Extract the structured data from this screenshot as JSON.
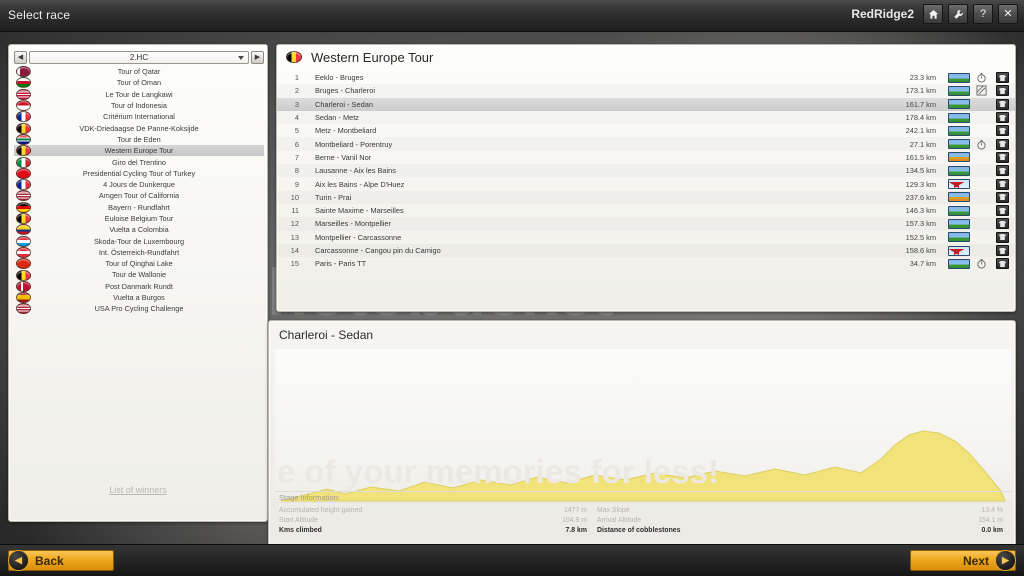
{
  "titlebar": {
    "title": "Select race",
    "user": "RedRidge2",
    "buttons": [
      {
        "name": "home-icon",
        "glyph": "⌂"
      },
      {
        "name": "wrench-icon",
        "glyph": "⚒"
      },
      {
        "name": "help-icon",
        "glyph": "?"
      },
      {
        "name": "close-icon",
        "glyph": "✕"
      }
    ]
  },
  "watermark": {
    "main": "photobucket",
    "sub": "Protect more of your memories for less!",
    "graph": "e of your memories for less!"
  },
  "left_panel": {
    "category_selector": {
      "value": "2.HC",
      "prev_label": "◀",
      "next_label": "▶"
    },
    "winners_link": "List of winners",
    "races": [
      {
        "name": "Tour of Qatar",
        "flag": "qatar",
        "selected": false
      },
      {
        "name": "Tour of Oman",
        "flag": "oman",
        "selected": false
      },
      {
        "name": "Le Tour de Langkawi",
        "flag": "malaysia",
        "selected": false
      },
      {
        "name": "Tour of Indonesia",
        "flag": "indonesia",
        "selected": false
      },
      {
        "name": "Critérium International",
        "flag": "france",
        "selected": false
      },
      {
        "name": "VDK-Driedaagse De Panne-Koksijde",
        "flag": "belgium",
        "selected": false
      },
      {
        "name": "Tour de Eden",
        "flag": "southafrica",
        "selected": false
      },
      {
        "name": "Western Europe Tour",
        "flag": "belgium",
        "selected": true
      },
      {
        "name": "Giro del Trentino",
        "flag": "italy",
        "selected": false
      },
      {
        "name": "Presidential Cycling Tour of Turkey",
        "flag": "turkey",
        "selected": false
      },
      {
        "name": "4 Jours de Dunkerque",
        "flag": "france",
        "selected": false
      },
      {
        "name": "Amgen Tour of California",
        "flag": "usa",
        "selected": false
      },
      {
        "name": "Bayern - Rundfahrt",
        "flag": "germany",
        "selected": false
      },
      {
        "name": "Euloise Belgium Tour",
        "flag": "belgium",
        "selected": false
      },
      {
        "name": "Vuelta a Colombia",
        "flag": "colombia",
        "selected": false
      },
      {
        "name": "Skoda-Tour de Luxembourg",
        "flag": "luxembourg",
        "selected": false
      },
      {
        "name": "Int. Österreich-Rundfahrt",
        "flag": "austria",
        "selected": false
      },
      {
        "name": "Tour of Qinghai Lake",
        "flag": "china",
        "selected": false
      },
      {
        "name": "Tour de Wallonie",
        "flag": "belgium",
        "selected": false
      },
      {
        "name": "Post Danmark Rundt",
        "flag": "denmark",
        "selected": false
      },
      {
        "name": "Vuelta a Burgos",
        "flag": "spain",
        "selected": false
      },
      {
        "name": "USA Pro Cycling Challenge",
        "flag": "usa",
        "selected": false
      }
    ]
  },
  "stage_panel": {
    "race_title": "Western Europe Tour",
    "race_flag": "belgium",
    "stages": [
      {
        "num": "1",
        "name": "Eeklo - Bruges",
        "distance": "23.3 km",
        "profile": "flat",
        "timetrial": "stopwatch",
        "selected": false
      },
      {
        "num": "2",
        "name": "Bruges - Charleroi",
        "distance": "173.1 km",
        "profile": "flat",
        "timetrial": "cobbles",
        "selected": false
      },
      {
        "num": "3",
        "name": "Charleroi - Sedan",
        "distance": "161.7 km",
        "profile": "flat",
        "timetrial": "",
        "selected": true
      },
      {
        "num": "4",
        "name": "Sedan - Metz",
        "distance": "178.4 km",
        "profile": "flat",
        "timetrial": "",
        "selected": false
      },
      {
        "num": "5",
        "name": "Metz - Montbeliard",
        "distance": "242.1 km",
        "profile": "flat",
        "timetrial": "",
        "selected": false
      },
      {
        "num": "6",
        "name": "Montbeliard - Porentruy",
        "distance": "27.1 km",
        "profile": "flat",
        "timetrial": "stopwatch",
        "selected": false
      },
      {
        "num": "7",
        "name": "Berne - Vanil Nor",
        "distance": "161.5 km",
        "profile": "hill",
        "timetrial": "",
        "selected": false
      },
      {
        "num": "8",
        "name": "Lausanne - Aix les Bains",
        "distance": "134.5 km",
        "profile": "flat",
        "timetrial": "",
        "selected": false
      },
      {
        "num": "9",
        "name": "Aix les Bains - Alpe D'Huez",
        "distance": "129.3 km",
        "profile": "mountain",
        "timetrial": "",
        "selected": false
      },
      {
        "num": "10",
        "name": "Turin - Prai",
        "distance": "237.6 km",
        "profile": "hill",
        "timetrial": "",
        "selected": false
      },
      {
        "num": "11",
        "name": "Sainte Maxime - Marseilles",
        "distance": "146.3 km",
        "profile": "flat",
        "timetrial": "",
        "selected": false
      },
      {
        "num": "12",
        "name": "Marseilles - Montpellier",
        "distance": "157.3 km",
        "profile": "flat",
        "timetrial": "",
        "selected": false
      },
      {
        "num": "13",
        "name": "Montpellier - Carcassonne",
        "distance": "152.5 km",
        "profile": "flat",
        "timetrial": "",
        "selected": false
      },
      {
        "num": "14",
        "name": "Carcassonne - Cangou pin du Camigo",
        "distance": "158.6 km",
        "profile": "mountain",
        "timetrial": "",
        "selected": false
      },
      {
        "num": "15",
        "name": "Paris - Paris TT",
        "distance": "34.7 km",
        "profile": "flat",
        "timetrial": "stopwatch",
        "selected": false
      }
    ]
  },
  "detail_panel": {
    "title": "Charleroi - Sedan",
    "stage_information_label": "Stage information:",
    "info": [
      {
        "left_label": "Accumulated height gained",
        "left_value": "1477 m",
        "right_label": "Max Slope",
        "right_value": "13.4 %",
        "bold": false
      },
      {
        "left_label": "Start Altitude",
        "left_value": "104.9 m",
        "right_label": "Arrival Altitude",
        "right_value": "154.1 m",
        "bold": false
      },
      {
        "left_label": "Kms climbed",
        "left_value": "7.8 km",
        "right_label": "Distance of cobblestones",
        "right_value": "0.0 km",
        "bold": true
      }
    ]
  },
  "bottombar": {
    "back_label": "Back",
    "next_label": "Next",
    "back_arrow": "◀",
    "next_arrow": "▶"
  }
}
